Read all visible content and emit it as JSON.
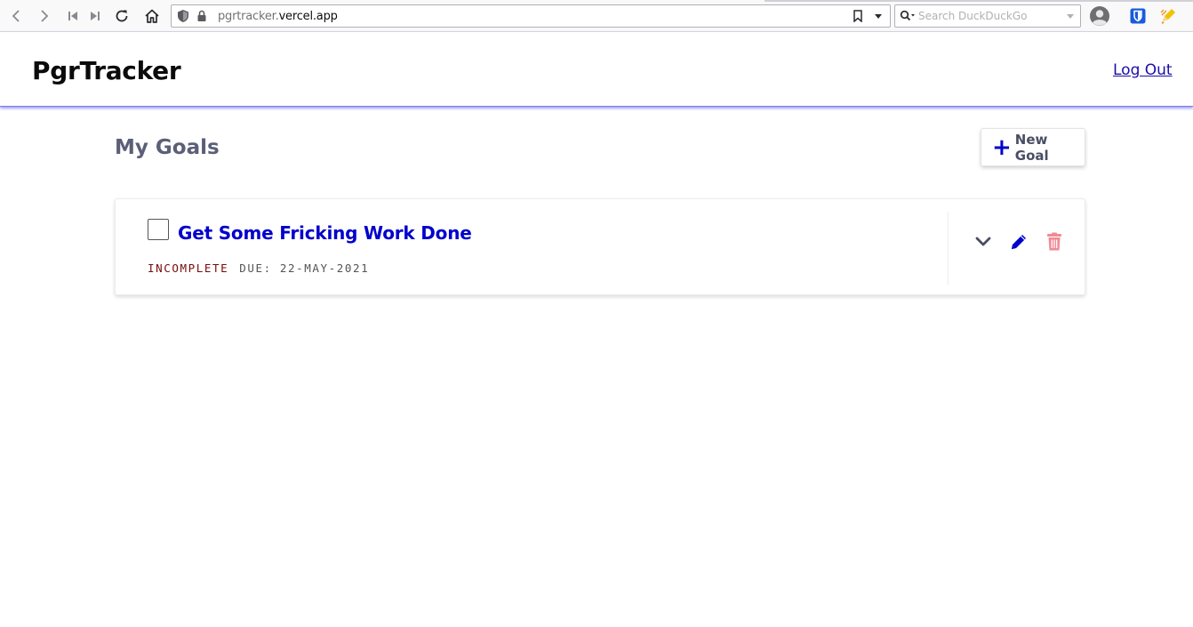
{
  "browser": {
    "url_host_dim": "pgrtracker.",
    "url_host_main": "vercel.app",
    "search_placeholder": "Search DuckDuckGo"
  },
  "header": {
    "brand": "PgrTracker",
    "logout_label": "Log Out"
  },
  "main": {
    "title": "My Goals",
    "new_goal_label": "New Goal",
    "goals": [
      {
        "title": "Get Some Fricking Work Done",
        "status": "INCOMPLETE",
        "due": "DUE: 22-MAY-2021",
        "checked": false
      }
    ]
  },
  "colors": {
    "accent": "#0000cc",
    "status_incomplete": "#7a0a0a",
    "delete": "#f08a96",
    "header_shadow": "#7b7bf0"
  }
}
